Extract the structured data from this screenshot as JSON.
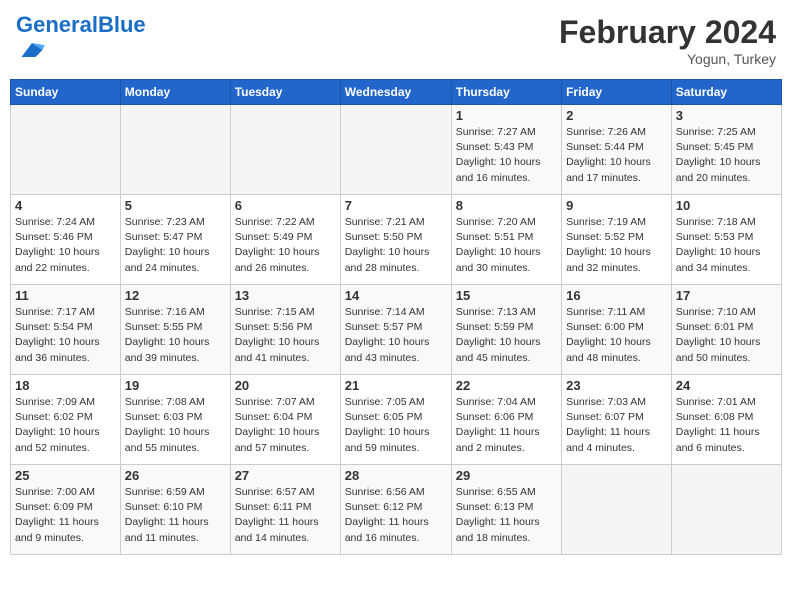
{
  "header": {
    "logo_general": "General",
    "logo_blue": "Blue",
    "month": "February 2024",
    "location": "Yogun, Turkey"
  },
  "days_of_week": [
    "Sunday",
    "Monday",
    "Tuesday",
    "Wednesday",
    "Thursday",
    "Friday",
    "Saturday"
  ],
  "weeks": [
    [
      {
        "day": "",
        "info": ""
      },
      {
        "day": "",
        "info": ""
      },
      {
        "day": "",
        "info": ""
      },
      {
        "day": "",
        "info": ""
      },
      {
        "day": "1",
        "info": "Sunrise: 7:27 AM\nSunset: 5:43 PM\nDaylight: 10 hours\nand 16 minutes."
      },
      {
        "day": "2",
        "info": "Sunrise: 7:26 AM\nSunset: 5:44 PM\nDaylight: 10 hours\nand 17 minutes."
      },
      {
        "day": "3",
        "info": "Sunrise: 7:25 AM\nSunset: 5:45 PM\nDaylight: 10 hours\nand 20 minutes."
      }
    ],
    [
      {
        "day": "4",
        "info": "Sunrise: 7:24 AM\nSunset: 5:46 PM\nDaylight: 10 hours\nand 22 minutes."
      },
      {
        "day": "5",
        "info": "Sunrise: 7:23 AM\nSunset: 5:47 PM\nDaylight: 10 hours\nand 24 minutes."
      },
      {
        "day": "6",
        "info": "Sunrise: 7:22 AM\nSunset: 5:49 PM\nDaylight: 10 hours\nand 26 minutes."
      },
      {
        "day": "7",
        "info": "Sunrise: 7:21 AM\nSunset: 5:50 PM\nDaylight: 10 hours\nand 28 minutes."
      },
      {
        "day": "8",
        "info": "Sunrise: 7:20 AM\nSunset: 5:51 PM\nDaylight: 10 hours\nand 30 minutes."
      },
      {
        "day": "9",
        "info": "Sunrise: 7:19 AM\nSunset: 5:52 PM\nDaylight: 10 hours\nand 32 minutes."
      },
      {
        "day": "10",
        "info": "Sunrise: 7:18 AM\nSunset: 5:53 PM\nDaylight: 10 hours\nand 34 minutes."
      }
    ],
    [
      {
        "day": "11",
        "info": "Sunrise: 7:17 AM\nSunset: 5:54 PM\nDaylight: 10 hours\nand 36 minutes."
      },
      {
        "day": "12",
        "info": "Sunrise: 7:16 AM\nSunset: 5:55 PM\nDaylight: 10 hours\nand 39 minutes."
      },
      {
        "day": "13",
        "info": "Sunrise: 7:15 AM\nSunset: 5:56 PM\nDaylight: 10 hours\nand 41 minutes."
      },
      {
        "day": "14",
        "info": "Sunrise: 7:14 AM\nSunset: 5:57 PM\nDaylight: 10 hours\nand 43 minutes."
      },
      {
        "day": "15",
        "info": "Sunrise: 7:13 AM\nSunset: 5:59 PM\nDaylight: 10 hours\nand 45 minutes."
      },
      {
        "day": "16",
        "info": "Sunrise: 7:11 AM\nSunset: 6:00 PM\nDaylight: 10 hours\nand 48 minutes."
      },
      {
        "day": "17",
        "info": "Sunrise: 7:10 AM\nSunset: 6:01 PM\nDaylight: 10 hours\nand 50 minutes."
      }
    ],
    [
      {
        "day": "18",
        "info": "Sunrise: 7:09 AM\nSunset: 6:02 PM\nDaylight: 10 hours\nand 52 minutes."
      },
      {
        "day": "19",
        "info": "Sunrise: 7:08 AM\nSunset: 6:03 PM\nDaylight: 10 hours\nand 55 minutes."
      },
      {
        "day": "20",
        "info": "Sunrise: 7:07 AM\nSunset: 6:04 PM\nDaylight: 10 hours\nand 57 minutes."
      },
      {
        "day": "21",
        "info": "Sunrise: 7:05 AM\nSunset: 6:05 PM\nDaylight: 10 hours\nand 59 minutes."
      },
      {
        "day": "22",
        "info": "Sunrise: 7:04 AM\nSunset: 6:06 PM\nDaylight: 11 hours\nand 2 minutes."
      },
      {
        "day": "23",
        "info": "Sunrise: 7:03 AM\nSunset: 6:07 PM\nDaylight: 11 hours\nand 4 minutes."
      },
      {
        "day": "24",
        "info": "Sunrise: 7:01 AM\nSunset: 6:08 PM\nDaylight: 11 hours\nand 6 minutes."
      }
    ],
    [
      {
        "day": "25",
        "info": "Sunrise: 7:00 AM\nSunset: 6:09 PM\nDaylight: 11 hours\nand 9 minutes."
      },
      {
        "day": "26",
        "info": "Sunrise: 6:59 AM\nSunset: 6:10 PM\nDaylight: 11 hours\nand 11 minutes."
      },
      {
        "day": "27",
        "info": "Sunrise: 6:57 AM\nSunset: 6:11 PM\nDaylight: 11 hours\nand 14 minutes."
      },
      {
        "day": "28",
        "info": "Sunrise: 6:56 AM\nSunset: 6:12 PM\nDaylight: 11 hours\nand 16 minutes."
      },
      {
        "day": "29",
        "info": "Sunrise: 6:55 AM\nSunset: 6:13 PM\nDaylight: 11 hours\nand 18 minutes."
      },
      {
        "day": "",
        "info": ""
      },
      {
        "day": "",
        "info": ""
      }
    ]
  ]
}
